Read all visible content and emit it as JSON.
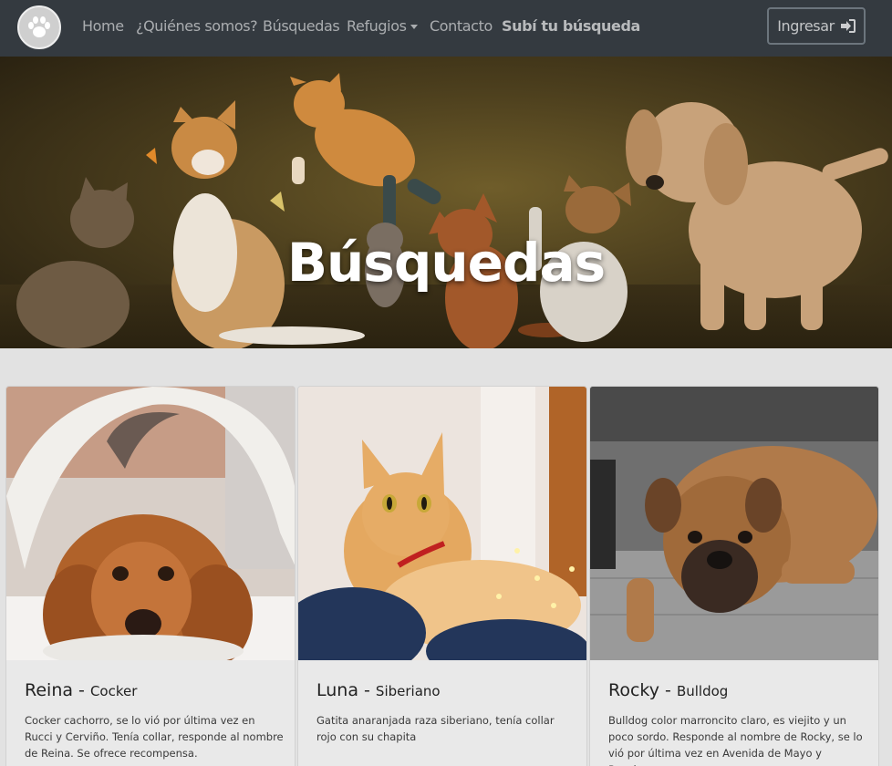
{
  "nav": {
    "links": [
      "Home",
      "¿Quiénes somos?",
      "Búsquedas",
      "Refugios",
      "Contacto",
      "Subí tu búsqueda"
    ],
    "login_label": "Ingresar"
  },
  "hero": {
    "title": "Búsquedas"
  },
  "cards": [
    {
      "name": "Reina",
      "breed": "Cocker",
      "description": "Cocker cachorro, se lo vió por última vez en Rucci y Cerviño. Tenía collar, responde al nombre de Reina. Se ofrece recompensa."
    },
    {
      "name": "Luna",
      "breed": "Siberiano",
      "description": "Gatita anaranjada raza siberiano, tenía collar rojo con su chapita"
    },
    {
      "name": "Rocky",
      "breed": "Bulldog",
      "description": "Bulldog color marroncito claro, es viejito y un poco sordo. Responde al nombre de Rocky, se lo vió por última vez en Avenida de Mayo y Rosales."
    }
  ],
  "colors": {
    "navbar": "#343a40",
    "page_bg": "#e2e2e2",
    "card_bg": "#e9e9e9"
  },
  "icons": {
    "logo": "paw-icon",
    "login": "sign-in-icon"
  }
}
